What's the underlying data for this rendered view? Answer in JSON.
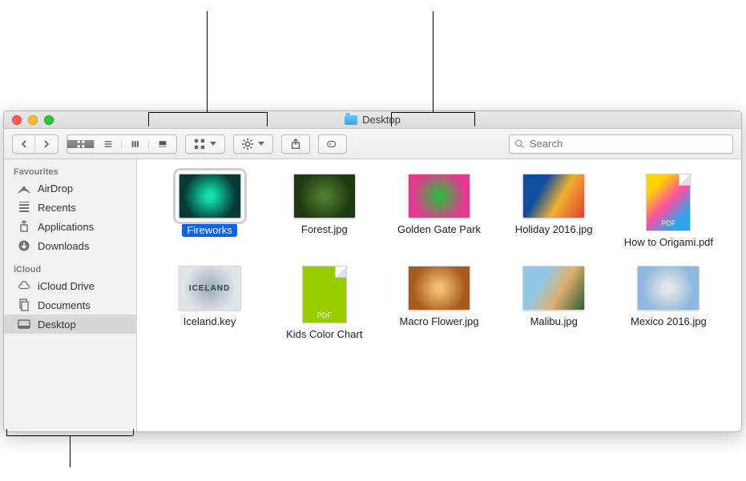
{
  "window": {
    "title": "Desktop"
  },
  "toolbar": {
    "search_placeholder": "Search"
  },
  "sidebar": {
    "sections": [
      {
        "header": "Favourites",
        "items": [
          {
            "icon": "airdrop-icon",
            "label": "AirDrop"
          },
          {
            "icon": "recents-icon",
            "label": "Recents"
          },
          {
            "icon": "applications-icon",
            "label": "Applications"
          },
          {
            "icon": "downloads-icon",
            "label": "Downloads"
          }
        ]
      },
      {
        "header": "iCloud",
        "items": [
          {
            "icon": "icloud-icon",
            "label": "iCloud Drive"
          },
          {
            "icon": "documents-icon",
            "label": "Documents"
          },
          {
            "icon": "desktop-icon",
            "label": "Desktop",
            "selected": true
          }
        ]
      }
    ]
  },
  "files": [
    {
      "name": "Fireworks",
      "kind": "image",
      "selected": true,
      "colors": [
        "#063a36",
        "#11e0a7"
      ]
    },
    {
      "name": "Forest.jpg",
      "kind": "image",
      "colors": [
        "#1e3a12",
        "#4e7a2c"
      ]
    },
    {
      "name": "Golden Gate Park",
      "kind": "image",
      "colors": [
        "#e23a8f",
        "#3cb043"
      ]
    },
    {
      "name": "Holiday 2016.jpg",
      "kind": "image",
      "colors": [
        "#104e9e",
        "#f0b030",
        "#e24030"
      ]
    },
    {
      "name": "How to Origami.pdf",
      "kind": "pdf-colorful"
    },
    {
      "name": "Iceland.key",
      "kind": "image",
      "colors": [
        "#dfe6ea",
        "#a7b3bb"
      ],
      "overlay_text": "ICELAND"
    },
    {
      "name": "Kids Color Chart",
      "kind": "pdf-green"
    },
    {
      "name": "Macro Flower.jpg",
      "kind": "image",
      "colors": [
        "#a85b1e",
        "#f0c070"
      ]
    },
    {
      "name": "Malibu.jpg",
      "kind": "image",
      "colors": [
        "#8fc9e8",
        "#e0b070",
        "#2a6030"
      ]
    },
    {
      "name": "Mexico 2016.jpg",
      "kind": "image",
      "colors": [
        "#8fb8e0",
        "#e6e6e6"
      ]
    }
  ],
  "pdf_label": "PDF"
}
